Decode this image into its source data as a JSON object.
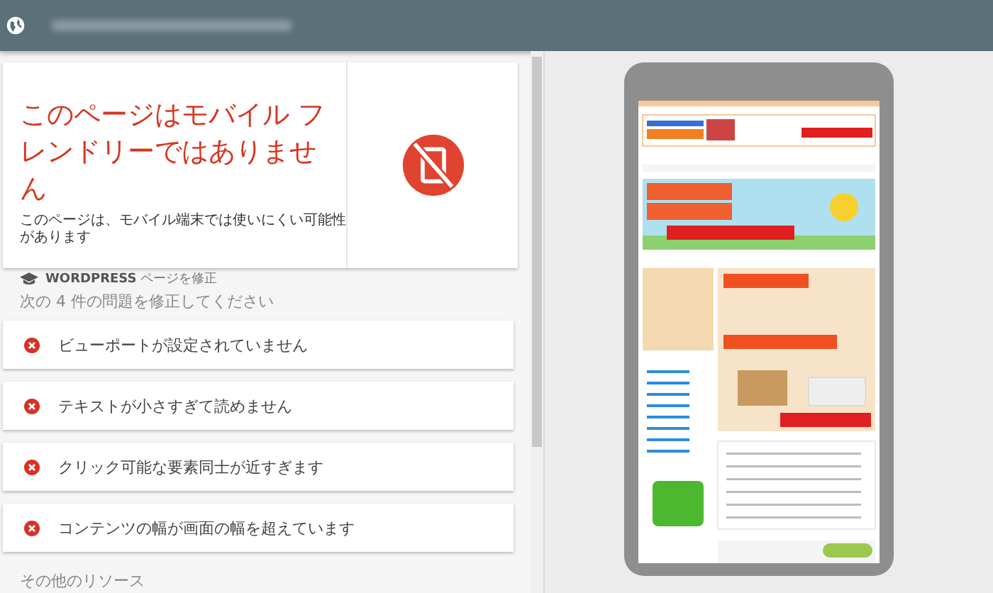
{
  "result_card": {
    "title": "このページはモバイル フレンドリーではありません",
    "description": "このページは、モバイル端末では使いにくい可能性があります",
    "fix_link": "**WORDPRESS** ページを修正"
  },
  "issues": {
    "heading": "次の 4 件の問題を修正してください",
    "items": [
      {
        "label": "ビューポートが設定されていません"
      },
      {
        "label": "テキストが小さすぎて読めません"
      },
      {
        "label": "クリック可能な要素同士が近すぎます"
      },
      {
        "label": "コンテンツの幅が画面の幅を超えています"
      }
    ]
  },
  "other_resources": {
    "heading": "その他のリソース"
  }
}
